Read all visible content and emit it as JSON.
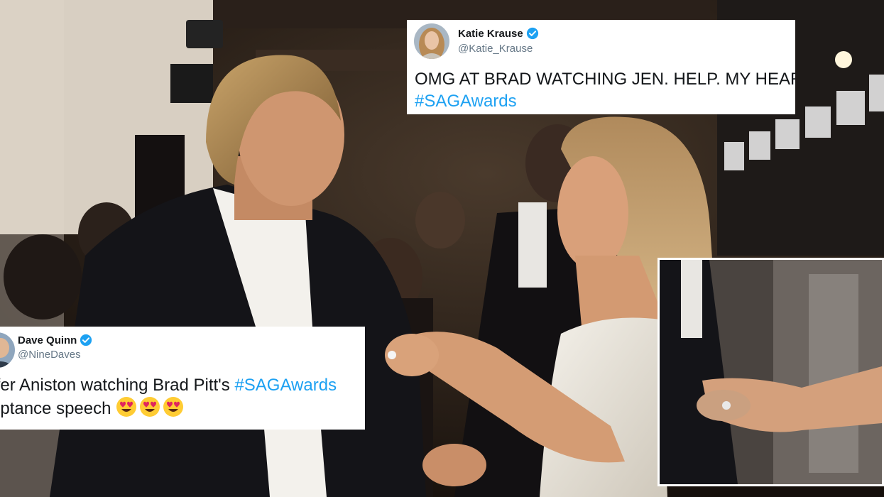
{
  "tweet_katie": {
    "name": "Katie Krause",
    "handle": "@Katie_Krause",
    "text": "OMG AT BRAD WATCHING JEN. HELP. MY HEART.",
    "hashtag": "#SAGAwards"
  },
  "tweet_dave": {
    "name": "Dave Quinn",
    "handle": "@NineDaves",
    "text_line1": "nifer Aniston watching Brad Pitt's ",
    "hashtag": "#SAGAwards",
    "text_line2": "ceptance speech "
  },
  "colors": {
    "hashtag": "#1da1f2",
    "verified_badge": "#1da1f2",
    "handle": "#657786"
  },
  "icons": {
    "verified": "verified-badge-icon",
    "emoji": "heart-eyes-emoji-icon"
  }
}
